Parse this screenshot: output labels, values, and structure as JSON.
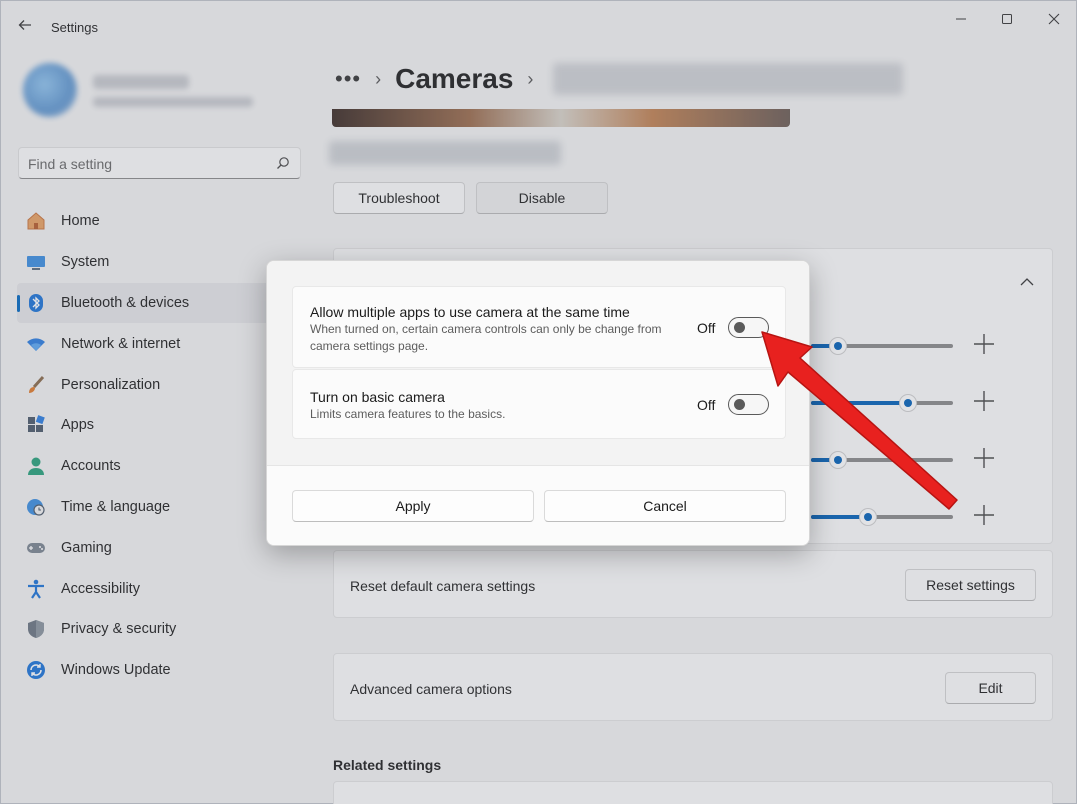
{
  "titlebar": {
    "app_title": "Settings",
    "back_icon": "arrow-left-icon",
    "minimize_icon": "minimize-icon",
    "maximize_icon": "maximize-icon",
    "close_icon": "close-icon"
  },
  "search": {
    "placeholder": "Find a setting",
    "icon": "search-icon"
  },
  "sidebar": {
    "items": [
      {
        "label": "Home",
        "icon": "home-icon",
        "active": false
      },
      {
        "label": "System",
        "icon": "monitor-icon",
        "active": false
      },
      {
        "label": "Bluetooth & devices",
        "icon": "bluetooth-icon",
        "active": true
      },
      {
        "label": "Network & internet",
        "icon": "wifi-icon",
        "active": false
      },
      {
        "label": "Personalization",
        "icon": "brush-icon",
        "active": false
      },
      {
        "label": "Apps",
        "icon": "apps-icon",
        "active": false
      },
      {
        "label": "Accounts",
        "icon": "person-icon",
        "active": false
      },
      {
        "label": "Time & language",
        "icon": "globe-clock-icon",
        "active": false
      },
      {
        "label": "Gaming",
        "icon": "gamepad-icon",
        "active": false
      },
      {
        "label": "Accessibility",
        "icon": "accessibility-icon",
        "active": false
      },
      {
        "label": "Privacy & security",
        "icon": "shield-icon",
        "active": false
      },
      {
        "label": "Windows Update",
        "icon": "update-icon",
        "active": false
      }
    ]
  },
  "breadcrumb": {
    "overflow": "•••",
    "title": "Cameras"
  },
  "actions": {
    "troubleshoot": "Troubleshoot",
    "disable": "Disable"
  },
  "sliders": [
    {
      "value": 0.19
    },
    {
      "value": 0.68
    },
    {
      "value": 0.19
    },
    {
      "value": 0.4
    }
  ],
  "reset": {
    "label": "Reset default camera settings",
    "button": "Reset settings"
  },
  "advanced": {
    "label": "Advanced camera options",
    "button": "Edit"
  },
  "related": {
    "title": "Related settings"
  },
  "dialog": {
    "options": [
      {
        "title": "Allow multiple apps to use camera at the same time",
        "description": "When turned on, certain camera controls can only be change from camera settings page.",
        "state": "Off",
        "on": false
      },
      {
        "title": "Turn on basic camera",
        "description": "Limits camera features to the basics.",
        "state": "Off",
        "on": false
      }
    ],
    "apply": "Apply",
    "cancel": "Cancel"
  },
  "colors": {
    "accent": "#005fb8",
    "annotation_arrow": "#e8211f"
  }
}
